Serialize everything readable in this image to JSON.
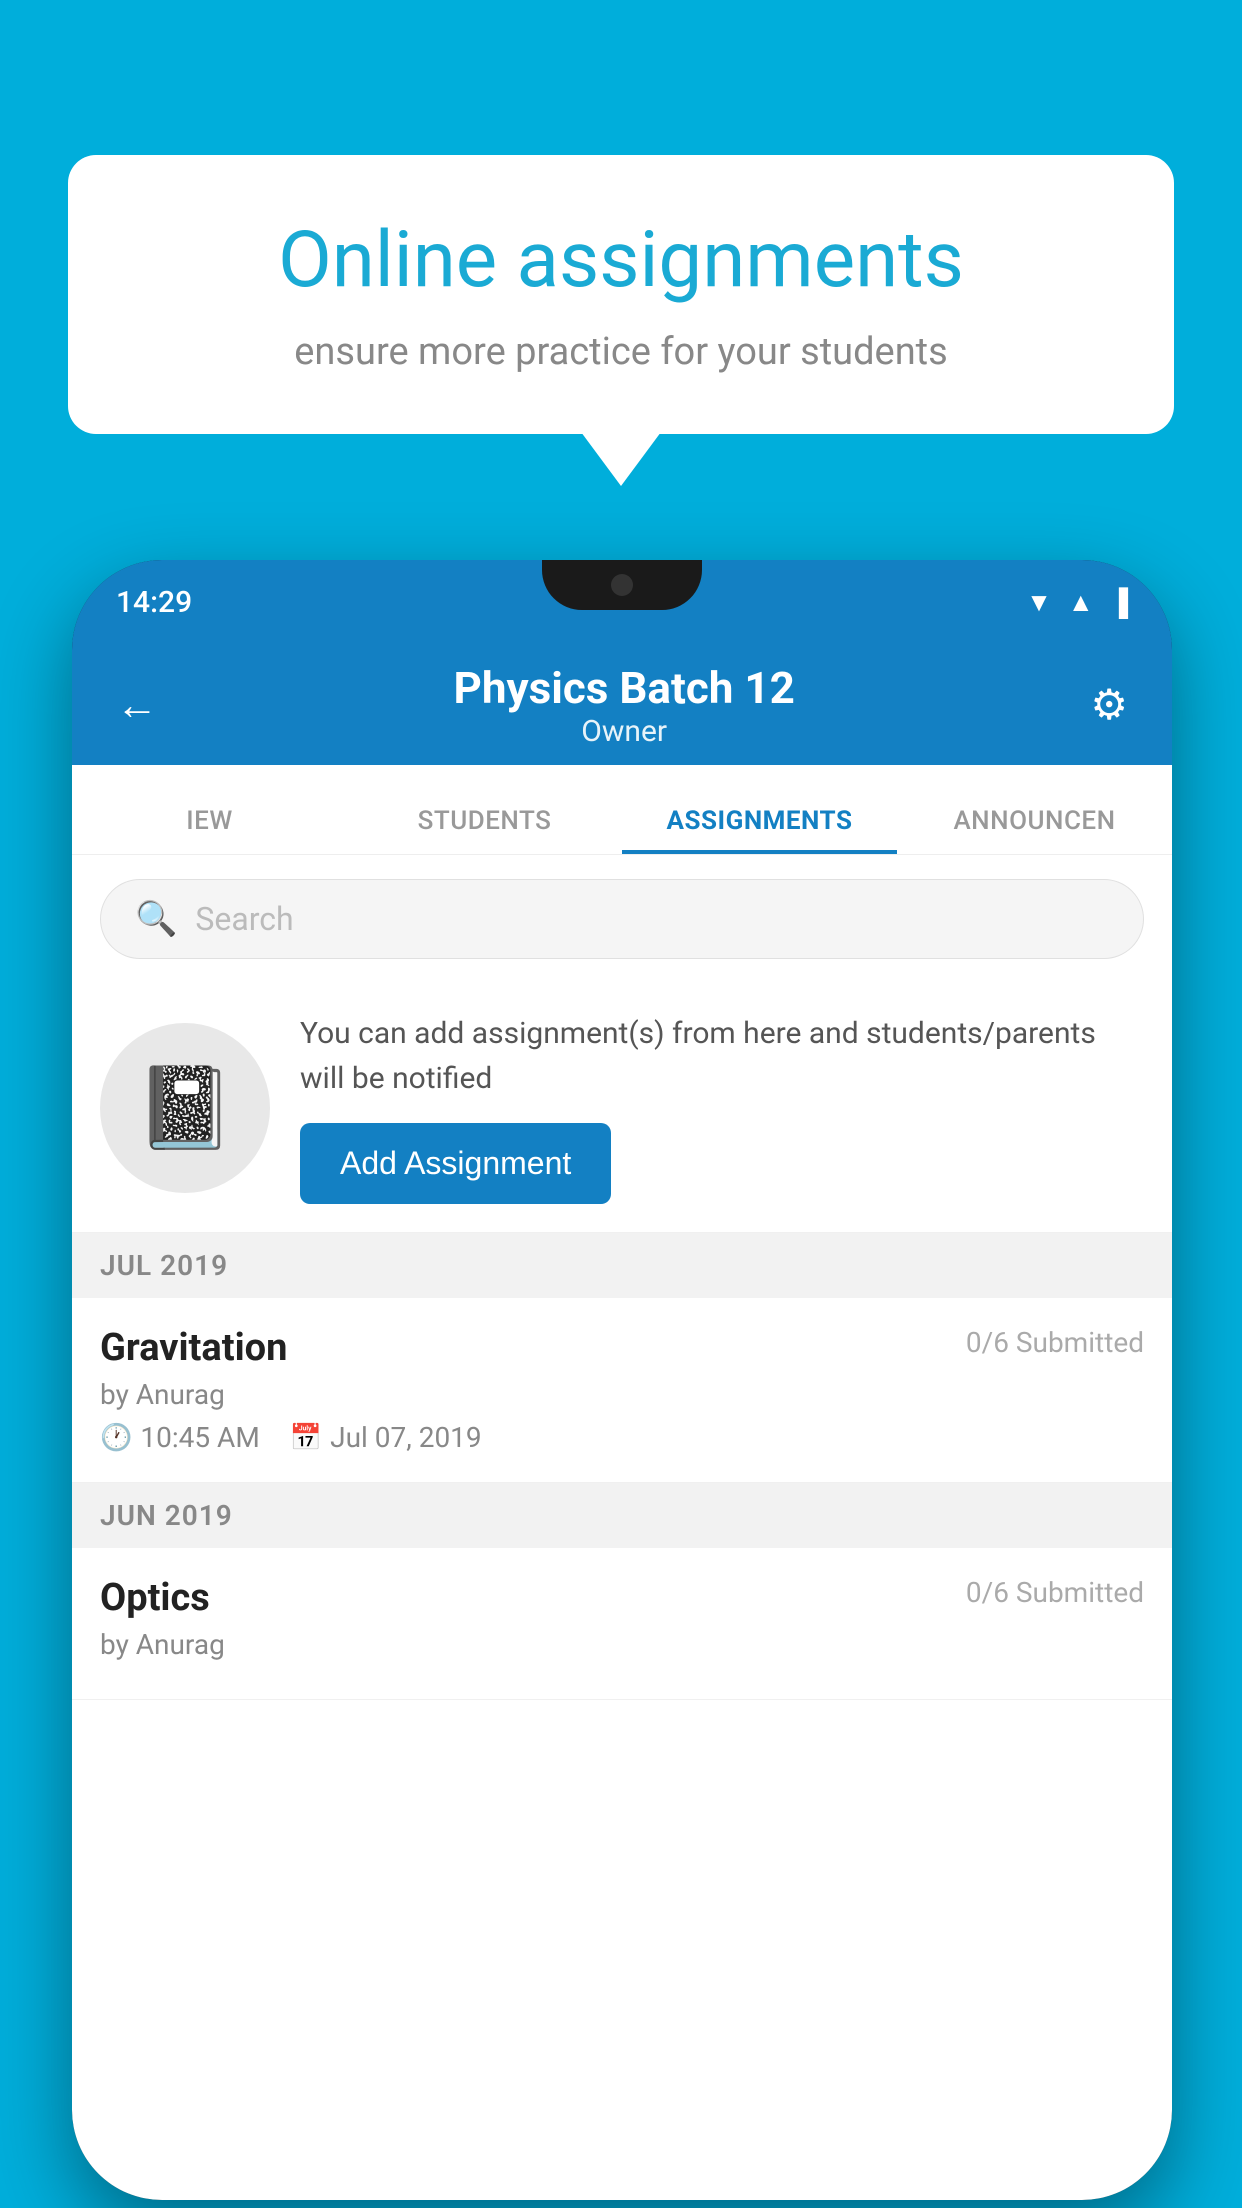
{
  "background_color": "#00AEDB",
  "speech_bubble": {
    "title": "Online assignments",
    "subtitle": "ensure more practice for your students"
  },
  "phone": {
    "status_bar": {
      "time": "14:29",
      "icons": [
        "wifi",
        "signal",
        "battery"
      ]
    },
    "header": {
      "title": "Physics Batch 12",
      "subtitle": "Owner",
      "back_label": "←",
      "settings_label": "⚙"
    },
    "tabs": [
      {
        "label": "IEW",
        "active": false
      },
      {
        "label": "STUDENTS",
        "active": false
      },
      {
        "label": "ASSIGNMENTS",
        "active": true
      },
      {
        "label": "ANNOUNCEN",
        "active": false
      }
    ],
    "search": {
      "placeholder": "Search"
    },
    "info_card": {
      "description": "You can add assignment(s) from here and students/parents will be notified",
      "button_label": "Add Assignment"
    },
    "sections": [
      {
        "header": "JUL 2019",
        "assignments": [
          {
            "name": "Gravitation",
            "submitted": "0/6 Submitted",
            "by": "by Anurag",
            "time": "10:45 AM",
            "date": "Jul 07, 2019"
          }
        ]
      },
      {
        "header": "JUN 2019",
        "assignments": [
          {
            "name": "Optics",
            "submitted": "0/6 Submitted",
            "by": "by Anurag",
            "time": "",
            "date": ""
          }
        ]
      }
    ]
  }
}
